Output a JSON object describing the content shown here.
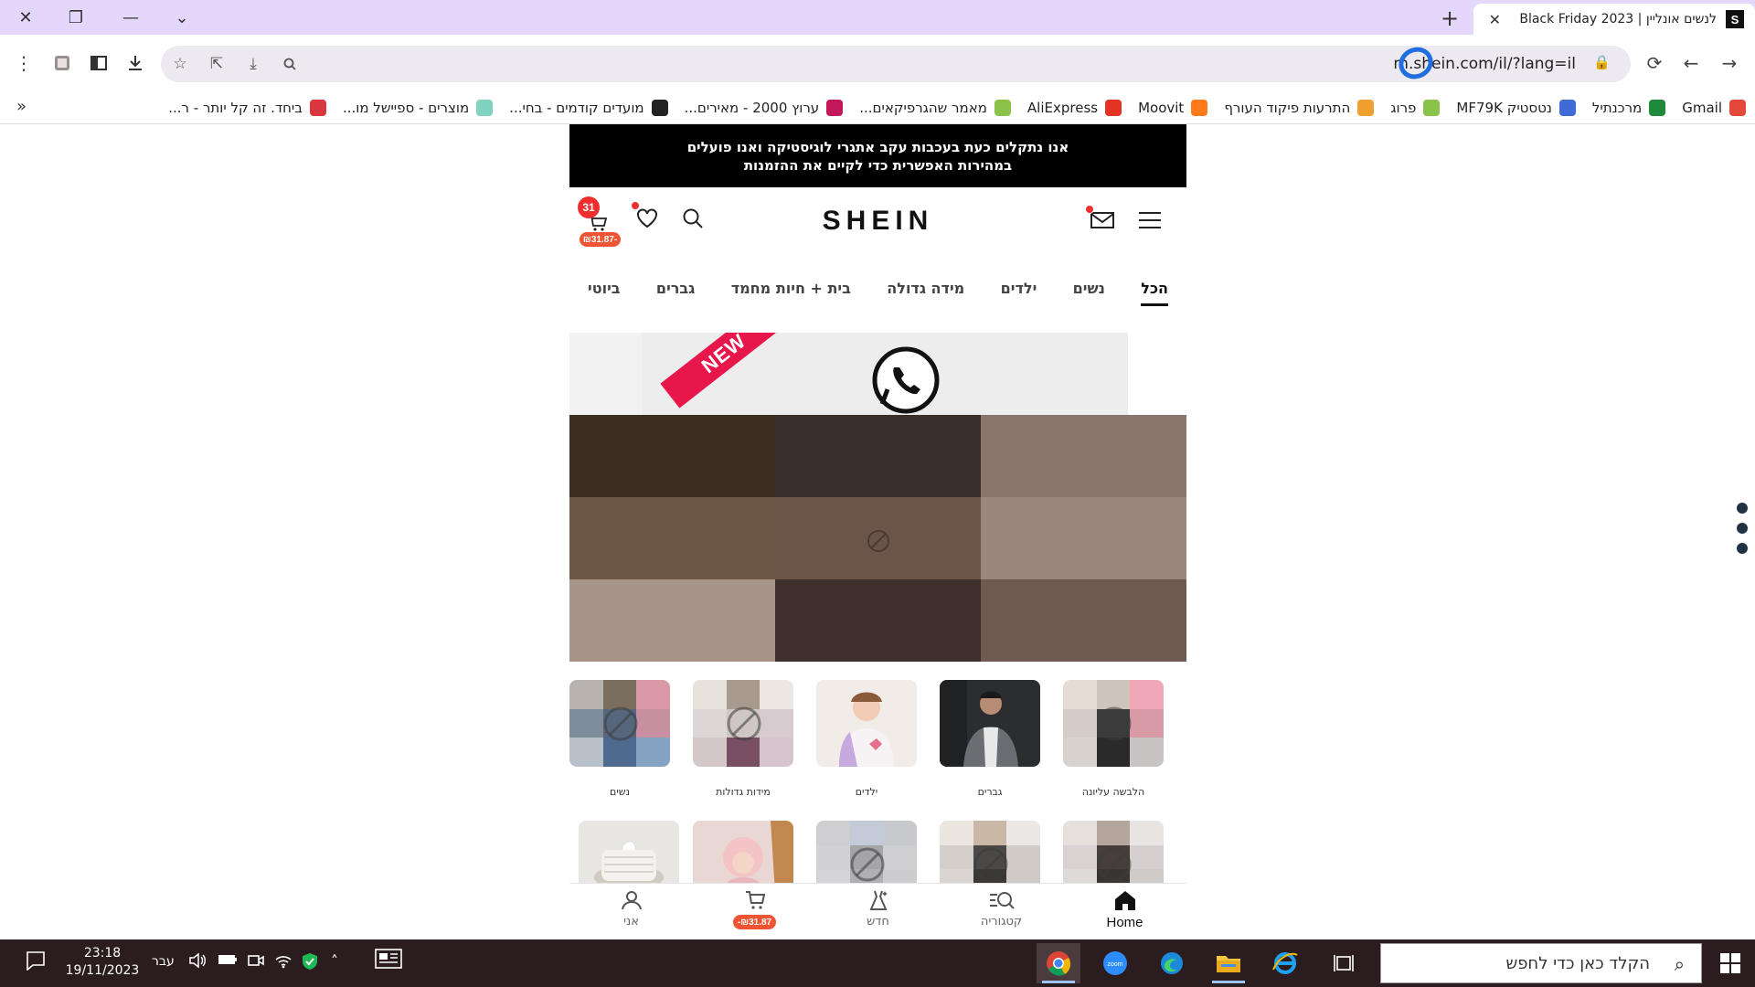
{
  "browser": {
    "tab_title": "Black Friday 2023 | לנשים אונליין",
    "tab_favicon": "S",
    "url": "m.shein.com/il/?lang=il",
    "bookmarks": [
      {
        "label": "Gmail",
        "icon": "gmail-icon",
        "color": "#e3483a"
      },
      {
        "label": "מרכנתיל",
        "icon": "mercantile-icon",
        "color": "#1e8a3a"
      },
      {
        "label": "נטסטיק MF79K",
        "icon": "netstick-icon",
        "color": "#3e6bd6"
      },
      {
        "label": "פרוג",
        "icon": "frog-icon",
        "color": "#8bc34a"
      },
      {
        "label": "התרעות פיקוד העורף",
        "icon": "home-front-icon",
        "color": "#f0a030"
      },
      {
        "label": "Moovit",
        "icon": "moovit-icon",
        "color": "#ff7a1a"
      },
      {
        "label": "AliExpress",
        "icon": "aliexpress-icon",
        "color": "#e43225"
      },
      {
        "label": "מאמר שהגרפיקאים...",
        "icon": "article-icon",
        "color": "#8bc34a"
      },
      {
        "label": "ערוץ 2000 - מאירים...",
        "icon": "channel-icon",
        "color": "#c2185b"
      },
      {
        "label": "מועדים קודמים - בחי...",
        "icon": "globe-icon",
        "color": "#222222"
      },
      {
        "label": "מוצרים - ספיישל מו...",
        "icon": "shield-bookmark-icon",
        "color": "#7fd3c0"
      },
      {
        "label": "ביחד. זה קל יותר - ר...",
        "icon": "together-icon",
        "color": "#d9363e"
      }
    ]
  },
  "site": {
    "notice_line1": "אנו נתקלים כעת בעכבות עקב אתגרי לוגיסטיקה ואנו פועלים",
    "notice_line2": "במהירות האפשרית כדי לקיים את ההזמנות",
    "logo": "SHEIN",
    "cart_count": "31",
    "cart_price": "₪31.87-",
    "tabs": [
      "הכל",
      "נשים",
      "ילדים",
      "מידה גדולה",
      "בית + חיות מחמד",
      "גברים",
      "ביוטי"
    ],
    "banner_ribbon": "NEW",
    "categories": [
      "הלבשה עליונה",
      "גברים",
      "ילדים",
      "מידות גדולות",
      "נשים"
    ],
    "bottom_nav": {
      "home": "Home",
      "category": "קטגוריה",
      "new": "חדש",
      "cart_price": "₪31.87-",
      "me": "אני"
    }
  },
  "taskbar": {
    "search_placeholder": "הקלד כאן כדי לחפש",
    "time": "23:18",
    "date": "19/11/2023",
    "lang": "עבר"
  },
  "colors": {
    "tabbar": "#e5d7fb",
    "accent_red": "#ef2f2f",
    "price_badge": "#ef5534",
    "taskbar": "#2b1c1f"
  }
}
